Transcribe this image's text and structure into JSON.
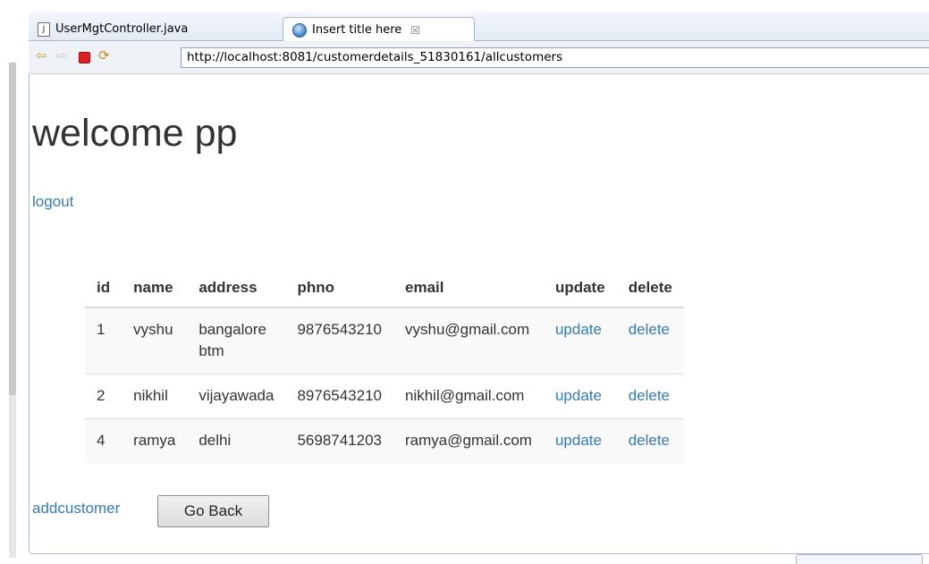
{
  "editor": {
    "tabs": [
      {
        "label": "UserMgtController.java",
        "icon": "java-file-icon"
      },
      {
        "label": "Insert title here",
        "icon": "globe-icon",
        "close": "☒"
      }
    ]
  },
  "browser": {
    "url": "http://localhost:8081/customerdetails_51830161/allcustomers"
  },
  "page": {
    "heading": "welcome pp",
    "logout_label": "logout",
    "table": {
      "headers": [
        "id",
        "name",
        "address",
        "phno",
        "email",
        "update",
        "delete"
      ],
      "rows": [
        {
          "id": "1",
          "name": "vyshu",
          "address_line1": "bangalore",
          "address_line2": "btm",
          "phno": "9876543210",
          "email": "vyshu@gmail.com",
          "update": "update",
          "delete": "delete"
        },
        {
          "id": "2",
          "name": "nikhil",
          "address_line1": "vijayawada",
          "address_line2": "",
          "phno": "8976543210",
          "email": "nikhil@gmail.com",
          "update": "update",
          "delete": "delete"
        },
        {
          "id": "4",
          "name": "ramya",
          "address_line1": "delhi",
          "address_line2": "",
          "phno": "5698741203",
          "email": "ramya@gmail.com",
          "update": "update",
          "delete": "delete"
        }
      ]
    },
    "addcustomer_label": "addcustomer",
    "goback_label": "Go Back"
  },
  "colors": {
    "link": "#337ab7",
    "text": "#333333",
    "stripe": "#f9f9f9"
  }
}
